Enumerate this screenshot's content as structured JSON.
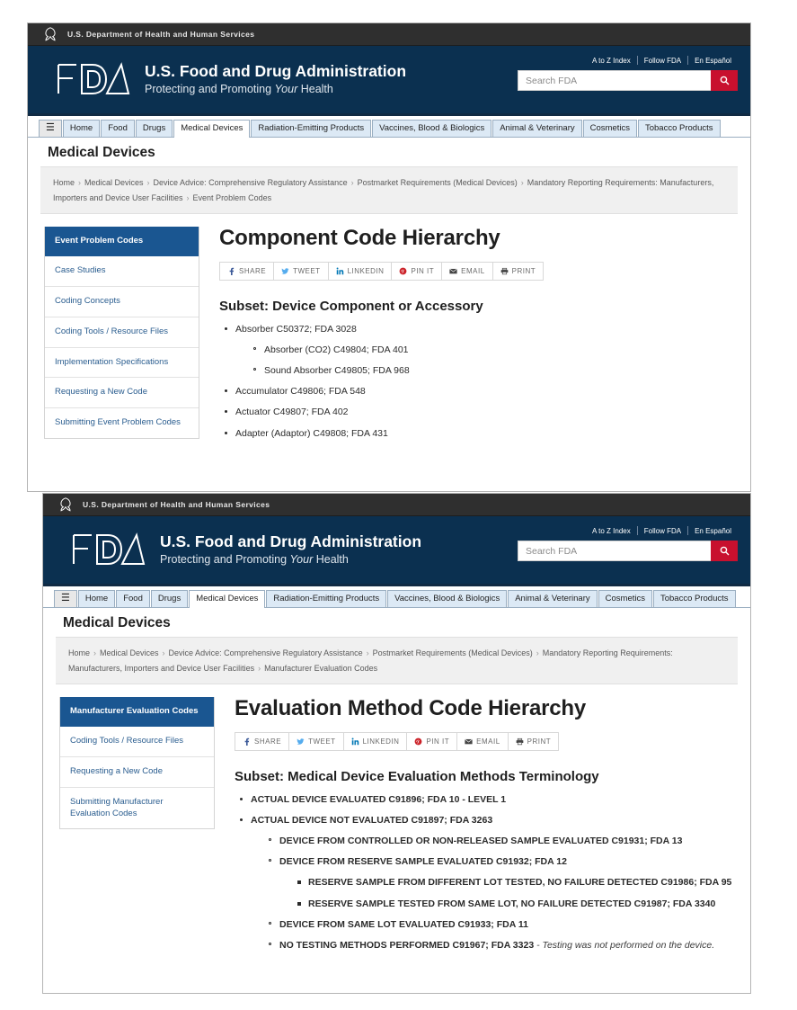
{
  "colors": {
    "hhs_banner_bg": "#2f2f2f",
    "fda_header_bg": "#0b3050",
    "search_button_bg": "#c8102e",
    "sidebar_active_bg": "#1a5691",
    "nav_tab_bg": "#dce9f5",
    "breadcrumb_bg": "#f0f0f0"
  },
  "hhs": {
    "text": "U.S. Department of Health and Human Services",
    "logo_icon": "hhs-seal-icon"
  },
  "header": {
    "agency_title": "U.S. Food and Drug Administration",
    "tagline_prefix": "Protecting and Promoting ",
    "tagline_italic": "Your",
    "tagline_suffix": " Health",
    "logo_icon": "fda-logo-icon",
    "util_links": [
      "A to Z Index",
      "Follow FDA",
      "En Español"
    ],
    "search": {
      "placeholder": "Search FDA",
      "value": "",
      "button_icon": "search-icon"
    }
  },
  "nav": {
    "hamburger_icon": "hamburger-menu-icon",
    "tabs": [
      {
        "label": "Home",
        "active": false
      },
      {
        "label": "Food",
        "active": false
      },
      {
        "label": "Drugs",
        "active": false
      },
      {
        "label": "Medical Devices",
        "active": true
      },
      {
        "label": "Radiation-Emitting Products",
        "active": false
      },
      {
        "label": "Vaccines, Blood & Biologics",
        "active": false
      },
      {
        "label": "Animal & Veterinary",
        "active": false
      },
      {
        "label": "Cosmetics",
        "active": false
      },
      {
        "label": "Tobacco Products",
        "active": false
      }
    ]
  },
  "share_bar": {
    "buttons": [
      {
        "label": "SHARE",
        "icon": "facebook-icon"
      },
      {
        "label": "TWEET",
        "icon": "twitter-icon"
      },
      {
        "label": "LINKEDIN",
        "icon": "linkedin-icon"
      },
      {
        "label": "PIN IT",
        "icon": "pinterest-icon"
      },
      {
        "label": "EMAIL",
        "icon": "email-icon"
      },
      {
        "label": "PRINT",
        "icon": "print-icon"
      }
    ]
  },
  "panel1": {
    "page_title": "Medical Devices",
    "breadcrumb": [
      "Home",
      "Medical Devices",
      "Device Advice: Comprehensive Regulatory Assistance",
      "Postmarket Requirements (Medical Devices)",
      "Mandatory Reporting Requirements: Manufacturers, Importers and Device User Facilities",
      "Event Problem Codes"
    ],
    "sidebar": [
      {
        "label": "Event Problem Codes",
        "active": true
      },
      {
        "label": "Case Studies",
        "active": false
      },
      {
        "label": "Coding Concepts",
        "active": false
      },
      {
        "label": "Coding Tools / Resource Files",
        "active": false
      },
      {
        "label": "Implementation Specifications",
        "active": false
      },
      {
        "label": "Requesting a New Code",
        "active": false
      },
      {
        "label": "Submitting Event Problem Codes",
        "active": false
      }
    ],
    "content_title": "Component Code Hierarchy",
    "subset_title": "Subset: Device Component or Accessory",
    "items": [
      {
        "level": 1,
        "text": "Absorber C50372; FDA 3028",
        "bold": false
      },
      {
        "level": 2,
        "text": "Absorber (CO2) C49804; FDA 401",
        "bold": false
      },
      {
        "level": 2,
        "text": "Sound Absorber C49805; FDA 968",
        "bold": false
      },
      {
        "level": 1,
        "text": "Accumulator C49806; FDA 548",
        "bold": false
      },
      {
        "level": 1,
        "text": "Actuator C49807; FDA 402",
        "bold": false
      },
      {
        "level": 1,
        "text": "Adapter (Adaptor) C49808; FDA 431",
        "bold": false
      }
    ]
  },
  "panel2": {
    "page_title": "Medical Devices",
    "breadcrumb": [
      "Home",
      "Medical Devices",
      "Device Advice: Comprehensive Regulatory Assistance",
      "Postmarket Requirements (Medical Devices)",
      "Mandatory Reporting Requirements: Manufacturers, Importers and Device User Facilities",
      "Manufacturer Evaluation Codes"
    ],
    "sidebar": [
      {
        "label": "Manufacturer Evaluation Codes",
        "active": true
      },
      {
        "label": "Coding Tools / Resource Files",
        "active": false
      },
      {
        "label": "Requesting a New Code",
        "active": false
      },
      {
        "label": "Submitting Manufacturer Evaluation Codes",
        "active": false
      }
    ],
    "content_title": "Evaluation Method Code Hierarchy",
    "subset_title": "Subset: Medical Device Evaluation Methods Terminology",
    "items": [
      {
        "level": 1,
        "text": "ACTUAL DEVICE EVALUATED C91896; FDA 10 - LEVEL 1",
        "bold": true
      },
      {
        "level": 1,
        "text": "ACTUAL DEVICE NOT EVALUATED C91897; FDA 3263",
        "bold": true
      },
      {
        "level": 2,
        "text": "DEVICE FROM CONTROLLED OR NON-RELEASED SAMPLE EVALUATED C91931; FDA 13",
        "bold": true
      },
      {
        "level": 2,
        "text": "DEVICE FROM RESERVE SAMPLE EVALUATED C91932; FDA 12",
        "bold": true
      },
      {
        "level": 3,
        "text": "RESERVE SAMPLE FROM DIFFERENT LOT TESTED, NO FAILURE DETECTED C91986; FDA 95",
        "bold": true
      },
      {
        "level": 3,
        "text": "RESERVE SAMPLE TESTED FROM SAME LOT, NO FAILURE DETECTED C91987; FDA 3340",
        "bold": true
      },
      {
        "level": 2,
        "text": "DEVICE FROM SAME LOT EVALUATED C91933; FDA 11",
        "bold": true
      },
      {
        "level": 2,
        "text": "NO TESTING METHODS PERFORMED C91967; FDA 3323",
        "bold": true,
        "note": " - Testing was not performed on the device."
      }
    ]
  }
}
